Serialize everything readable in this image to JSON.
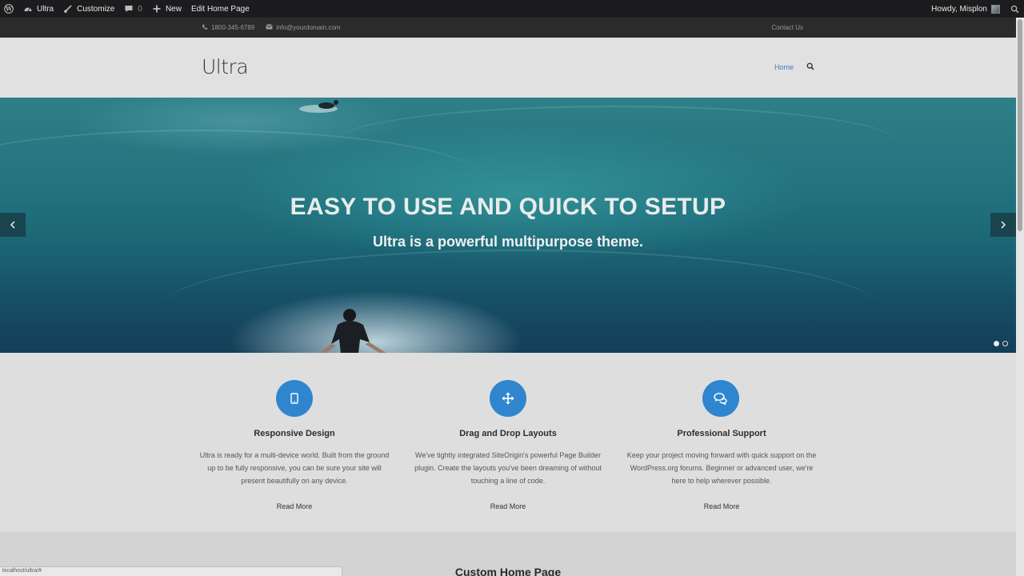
{
  "adminbar": {
    "site_name": "Ultra",
    "customize": "Customize",
    "comments_count": "0",
    "new": "New",
    "edit_page": "Edit Home Page",
    "howdy": "Howdy, Misplon"
  },
  "topbar": {
    "phone": "1800-345-6789",
    "email": "info@yourdomain.com",
    "contact": "Contact Us"
  },
  "header": {
    "logo": "Ultra",
    "nav_home": "Home"
  },
  "hero": {
    "title": "EASY TO USE AND QUICK TO SETUP",
    "subtitle": "Ultra is a powerful multipurpose theme.",
    "slides": 2,
    "active_slide": 1
  },
  "features": [
    {
      "icon": "tablet-icon",
      "title": "Responsive Design",
      "text": "Ultra is ready for a multi-device world. Built from the ground up to be fully responsive, you can be sure your site will present beautifully on any device.",
      "more": "Read More"
    },
    {
      "icon": "move-arrows-icon",
      "title": "Drag and Drop Layouts",
      "text": "We've tightly integrated SiteOrigin's powerful Page Builder plugin. Create the layouts you've been dreaming of without touching a line of code.",
      "more": "Read More"
    },
    {
      "icon": "chat-bubbles-icon",
      "title": "Professional Support",
      "text": "Keep your project moving forward with quick support on the WordPress.org forums. Beginner or advanced user, we're here to help wherever possible.",
      "more": "Read More"
    }
  ],
  "custom_section": {
    "title": "Custom Home Page"
  },
  "statusbar": {
    "url": "localhost/ultra/#"
  },
  "colors": {
    "accent": "#2f86cf",
    "nav_active": "#3a7bbf",
    "adminbar": "#1c1c1e"
  }
}
